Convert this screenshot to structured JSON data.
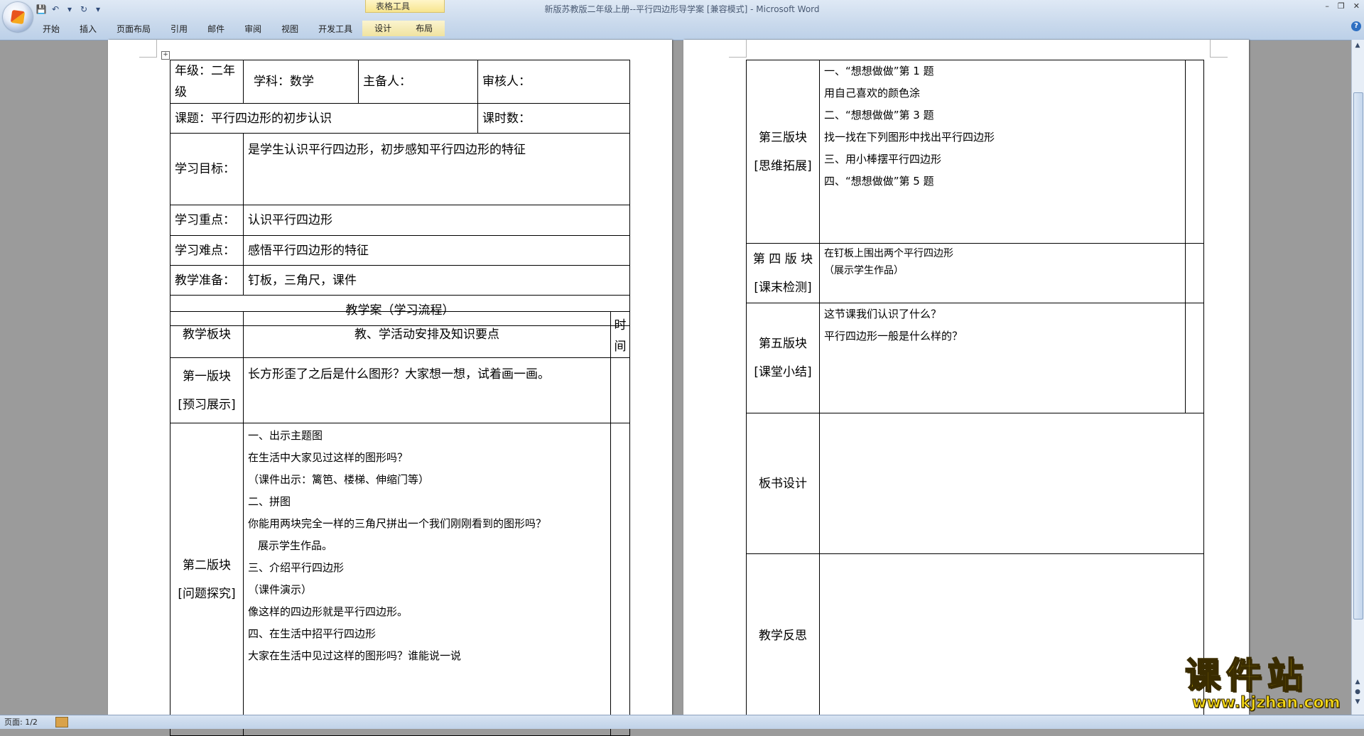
{
  "window": {
    "title": "新版苏教版二年级上册--平行四边形导学案 [兼容模式] - Microsoft Word",
    "context_group": "表格工具"
  },
  "ribbon": {
    "tabs": [
      "开始",
      "插入",
      "页面布局",
      "引用",
      "邮件",
      "审阅",
      "视图",
      "开发工具"
    ],
    "context_tabs": [
      "设计",
      "布局"
    ]
  },
  "page1": {
    "grade": "年级：二年级",
    "subject": "学科：数学",
    "preparer": "主备人：",
    "reviewer": "审核人：",
    "topic": "课题：平行四边形的初步认识",
    "periods": "课时数：",
    "goal_label": "学习目标：",
    "goal_text": "是学生认识平行四边形，初步感知平行四边形的特征",
    "key_label": "学习重点：",
    "key_text": "认识平行四边形",
    "difficulty_label": "学习难点：",
    "difficulty_text": "感悟平行四边形的特征",
    "prep_label": "教学准备：",
    "prep_text": "钉板，三角尺，课件",
    "flow_title": "教学案（学习流程）",
    "col_block": "教学板块",
    "col_activities": "教、学活动安排及知识要点",
    "col_time": "时间",
    "block1_name": "第一版块",
    "block1_sub": "[预习展示]",
    "block1_text": "长方形歪了之后是什么图形？大家想一想，试着画一画。",
    "block2_name": "第二版块",
    "block2_sub": "[问题探究]",
    "block2_lines": [
      "一、出示主题图",
      "在生活中大家见过这样的图形吗？",
      "（课件出示：篱笆、楼梯、伸缩门等）",
      "二、拼图",
      "你能用两块完全一样的三角尺拼出一个我们刚刚看到的图形吗？",
      "展示学生作品。",
      "三、介绍平行四边形",
      "（课件演示）",
      "像这样的四边形就是平行四边形。",
      "四、在生活中招平行四边形",
      "大家在生活中见过这样的图形吗？谁能说一说"
    ]
  },
  "page2": {
    "block3_name": "第三版块",
    "block3_sub": "[思维拓展]",
    "block3_lines": [
      "一、“想想做做”第 1 题",
      "用自己喜欢的颜色涂",
      "二、“想想做做”第 3 题",
      "找一找在下列图形中找出平行四边形",
      "三、用小棒摆平行四边形",
      "四、“想想做做”第 5 题"
    ],
    "block4_name": "第 四 版 块",
    "block4_sub": "[课末检测]",
    "block4_lines": [
      "在钉板上围出两个平行四边形",
      "（展示学生作品）"
    ],
    "block5_name": "第五版块",
    "block5_sub": "[课堂小结]",
    "block5_lines": [
      "这节课我们认识了什么？",
      "平行四边形一般是什么样的？"
    ],
    "board_label": "板书设计",
    "reflection_label": "教学反思"
  },
  "status": {
    "page": "页面: 1/2"
  },
  "watermark": {
    "brand": "课件站",
    "url": "www.kjzhan.com"
  },
  "colors": {
    "ribbon": "#c9d9ec",
    "workspace": "#9b9b9b",
    "watermark": "#f2d616"
  }
}
